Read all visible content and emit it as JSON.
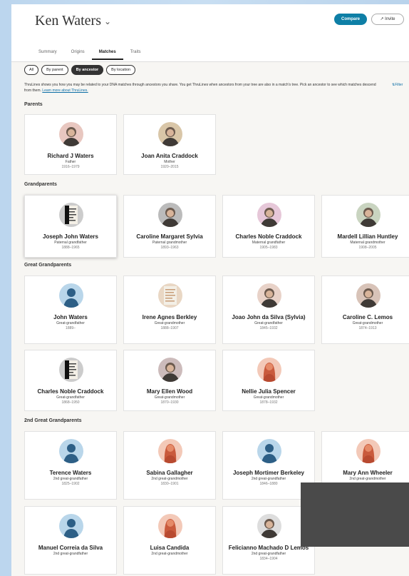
{
  "header": {
    "person_name": "Ken Waters",
    "compare_label": "Compare",
    "invite_label": "Invite",
    "tabs": [
      "Summary",
      "Origins",
      "Matches",
      "Traits"
    ],
    "active_tab": "Matches"
  },
  "filters": {
    "pills": [
      "All",
      "By parent",
      "By ancestor",
      "By location"
    ],
    "active": "By ancestor",
    "description": "ThruLines shows you how you may be related to your DNA matches through ancestors you share. You get ThruLines when ancestors from your tree are also in a match's tree. Pick an ancestor to see which matches descend from them.",
    "learn_more": "Learn more about ThruLines.",
    "filter_label": "Filter"
  },
  "sections": {
    "parents": "Parents",
    "grandparents": "Grandparents",
    "great_grandparents": "Great Grandparents",
    "second_great_grandparents": "2nd Great Grandparents"
  },
  "cards": [
    {
      "name": "Richard J Waters",
      "relation": "Father",
      "dates": "1916–1979",
      "avatar": "photo-man",
      "accent": "#e8c7c0"
    },
    {
      "name": "Joan Anita Craddock",
      "relation": "Mother",
      "dates": "1920–2015",
      "avatar": "photo-woman",
      "accent": "#d9c6a8"
    },
    {
      "name": "Joseph John Waters",
      "relation": "Paternal grandfather",
      "dates": "1888–1965",
      "avatar": "document",
      "accent": "#ccc"
    },
    {
      "name": "Caroline Margaret Sylvia",
      "relation": "Paternal grandmother",
      "dates": "1893–1963",
      "avatar": "photo-bw",
      "accent": "#bbb"
    },
    {
      "name": "Charles Noble Craddock",
      "relation": "Maternal grandfather",
      "dates": "1905–1983",
      "avatar": "photo-hat",
      "accent": "#e6c7d8"
    },
    {
      "name": "Mardell Lillian Huntley",
      "relation": "Maternal grandmother",
      "dates": "1908–2005",
      "avatar": "photo-group",
      "accent": "#c9d4c0"
    },
    {
      "name": "John Waters",
      "relation": "Great-grandfather",
      "dates": "1889–",
      "avatar": "male",
      "accent": "#b9d6ea"
    },
    {
      "name": "Irene Agnes Berkley",
      "relation": "Great-grandmother",
      "dates": "1888–1907",
      "avatar": "document-old",
      "accent": "#e9d7c4"
    },
    {
      "name": "Joao John da Silva (Sylvia)",
      "relation": "Great-grandfather",
      "dates": "1845–1932",
      "avatar": "photo-man-old",
      "accent": "#e8d2c8"
    },
    {
      "name": "Caroline C. Lemos",
      "relation": "Great-grandmother",
      "dates": "1874–1913",
      "avatar": "photo-colored",
      "accent": "#d8c3b8"
    },
    {
      "name": "Charles Noble Craddock",
      "relation": "Great-grandfather",
      "dates": "1868–1950",
      "avatar": "document",
      "accent": "#ccc"
    },
    {
      "name": "Mary Ellen Wood",
      "relation": "Great-grandmother",
      "dates": "1870–1930",
      "avatar": "photo-woman-old",
      "accent": "#cbb"
    },
    {
      "name": "Nellie Julia Spencer",
      "relation": "Great-grandmother",
      "dates": "1878–1932",
      "avatar": "female",
      "accent": "#f3c9b8"
    },
    {
      "name": "Terence Waters",
      "relation": "2nd great-grandfather",
      "dates": "1825–1902",
      "avatar": "male",
      "accent": "#b9d6ea"
    },
    {
      "name": "Sabina Gallagher",
      "relation": "2nd great-grandmother",
      "dates": "1830–1901",
      "avatar": "female",
      "accent": "#f3c9b8"
    },
    {
      "name": "Joseph Mortimer Berkeley",
      "relation": "2nd great-grandfather",
      "dates": "1846–1880",
      "avatar": "male",
      "accent": "#b9d6ea"
    },
    {
      "name": "Mary Ann Wheeler",
      "relation": "2nd great-grandmother",
      "dates": "",
      "avatar": "female",
      "accent": "#f3c9b8"
    },
    {
      "name": "Manuel Correia da Silva",
      "relation": "2nd great-grandfather",
      "dates": "",
      "avatar": "male",
      "accent": "#b9d6ea"
    },
    {
      "name": "Luisa Candida",
      "relation": "2nd great-grandmother",
      "dates": "",
      "avatar": "female",
      "accent": "#f3c9b8"
    },
    {
      "name": "Felicianno Machado D Lemos",
      "relation": "2nd great-grandfather",
      "dates": "1834–1904",
      "avatar": "photo-bearded",
      "accent": "#ddd"
    }
  ]
}
